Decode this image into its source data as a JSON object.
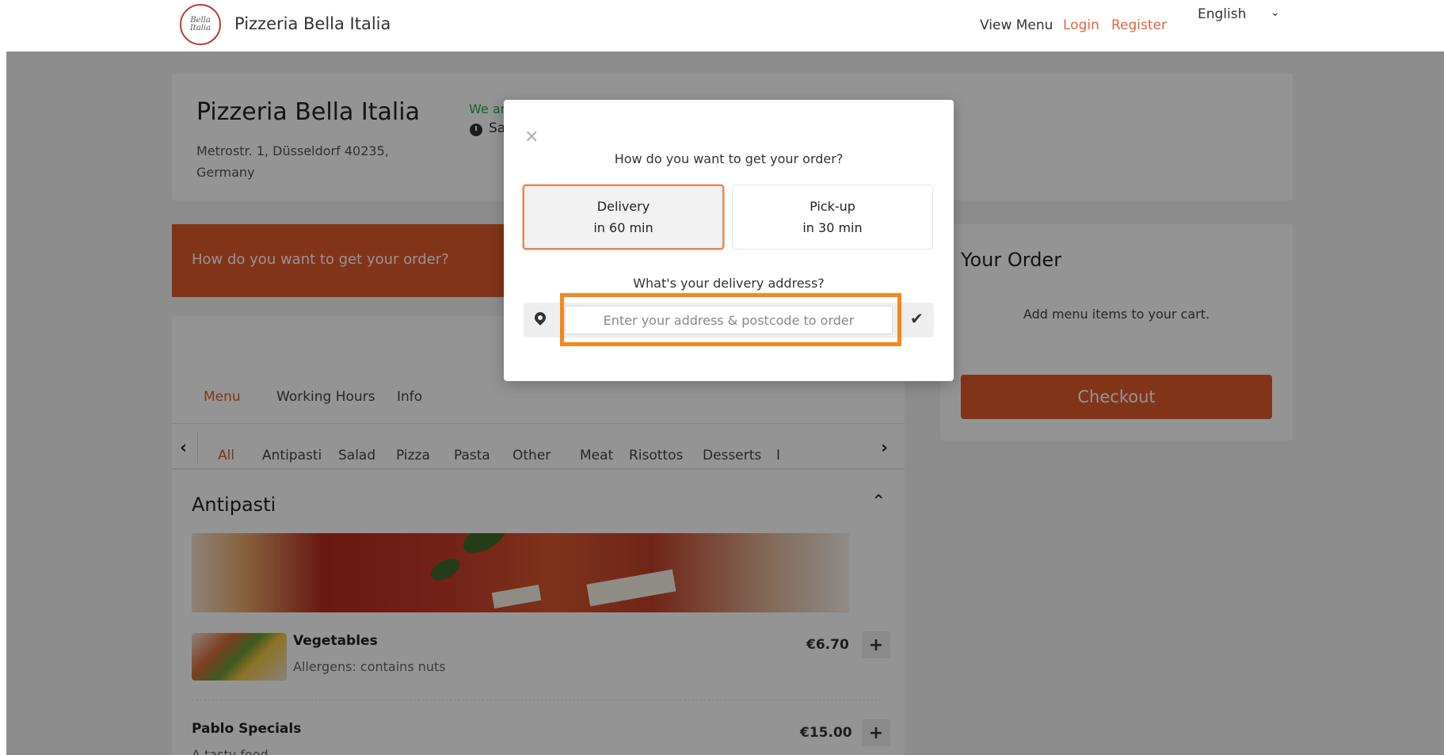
{
  "navbar": {
    "brand": "Pizzeria Bella Italia",
    "logo_text": "Bella Italia",
    "view_menu": "View Menu",
    "login": "Login",
    "register": "Register",
    "language": "English"
  },
  "restaurant": {
    "name": "Pizzeria Bella Italia",
    "address": "Metrostr. 1, Düsseldorf 40235, Germany",
    "open_status": "We are",
    "hours_day": "Sat"
  },
  "order_banner": "How do you want to get your order?",
  "tabs": [
    "Menu",
    "Working Hours",
    "Info"
  ],
  "categories": [
    "All",
    "Antipasti",
    "Salad",
    "Pizza",
    "Pasta",
    "Other",
    "Meat",
    "Risottos",
    "Desserts",
    "I"
  ],
  "section": {
    "title": "Antipasti"
  },
  "items": [
    {
      "name": "Vegetables",
      "desc": "Allergens: contains nuts",
      "price": "€6.70"
    },
    {
      "name": "Pablo Specials",
      "desc": "A tasty food",
      "price": "€15.00"
    }
  ],
  "cart": {
    "title": "Your Order",
    "empty": "Add menu items to your cart.",
    "checkout": "Checkout"
  },
  "modal": {
    "close": "×",
    "question": "How do you want to get your order?",
    "delivery": {
      "label": "Delivery",
      "time": "in 60 min"
    },
    "pickup": {
      "label": "Pick-up",
      "time": "in 30 min"
    },
    "address_question": "What's your delivery address?",
    "address_placeholder": "Enter your address & postcode to order"
  },
  "colors": {
    "accent": "#e05a2b",
    "link": "#e8633a",
    "highlight": "#f5871f",
    "open": "#27a844"
  },
  "icons": [
    "close-icon",
    "map-pin-icon",
    "check-icon",
    "chevron-left-icon",
    "chevron-right-icon",
    "chevron-up-icon",
    "chevron-down-icon",
    "clock-icon",
    "plus-icon"
  ]
}
